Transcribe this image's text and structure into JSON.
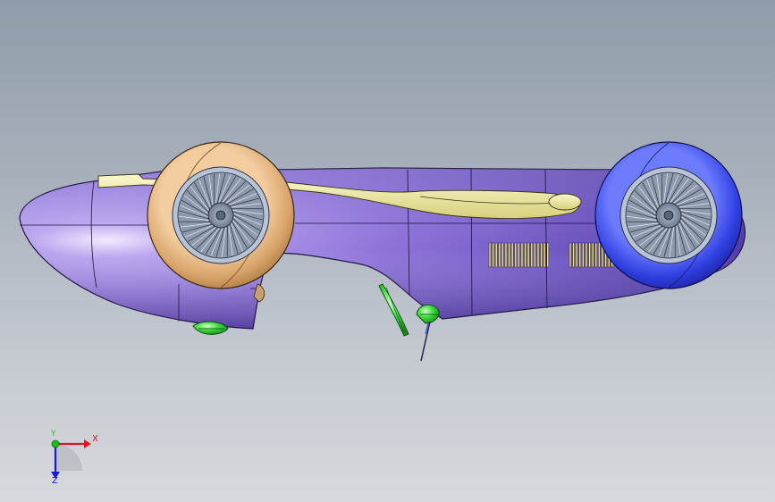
{
  "viewport": {
    "background_top": "#909caa",
    "background_bottom": "#d6d9dd"
  },
  "model": {
    "body_color": "#8a6fd8",
    "front_wheel_tire_color": "#d9a46a",
    "rear_wheel_tire_color": "#2f3fe0",
    "exhaust_color": "#eeeaa0",
    "accent_parts_color": "#39d83a"
  },
  "triad": {
    "x_label": "X",
    "y_label": "Y",
    "z_label": "Z",
    "x_color": "#e01818",
    "y_color": "#18c018",
    "z_color": "#1818e0"
  }
}
